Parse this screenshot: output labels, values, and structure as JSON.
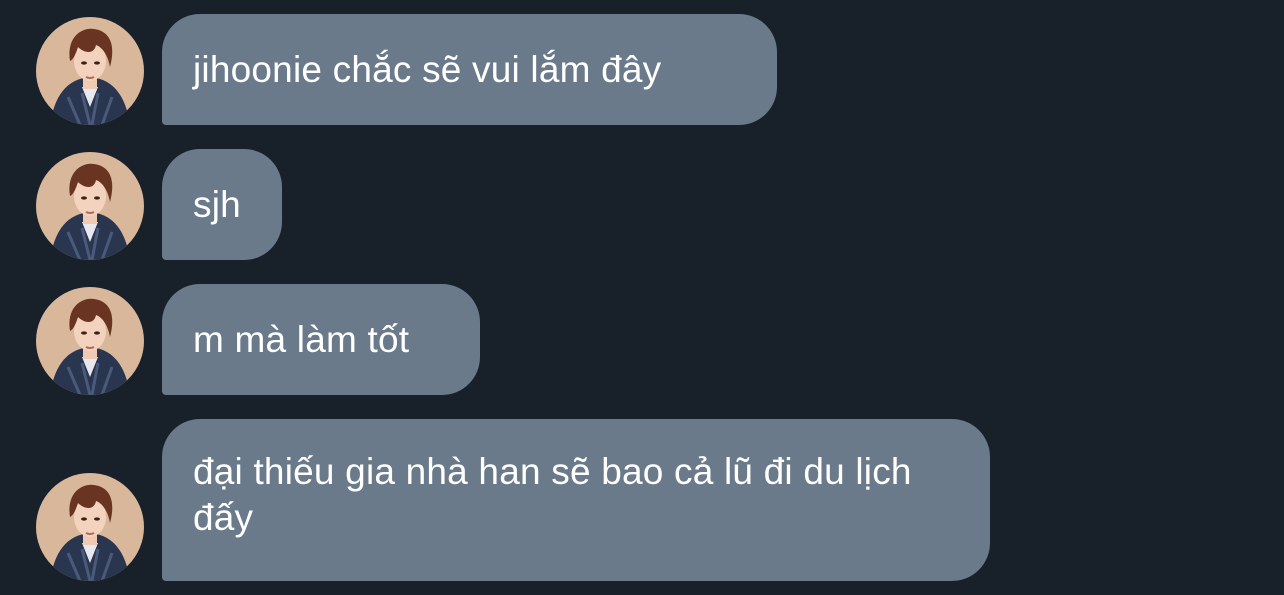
{
  "conversation": {
    "messages": [
      {
        "text": "jihoonie chắc sẽ vui lắm đây",
        "avatar": "avatar-photo"
      },
      {
        "text": "sjh",
        "avatar": "avatar-photo"
      },
      {
        "text": "m mà làm tốt",
        "avatar": "avatar-photo"
      },
      {
        "text": "đại thiếu gia nhà han sẽ bao cả lũ đi du lịch đấy",
        "avatar": "avatar-photo"
      }
    ]
  },
  "colors": {
    "background": "#18202a",
    "bubble": "#6a7a8a",
    "text": "#ffffff"
  }
}
